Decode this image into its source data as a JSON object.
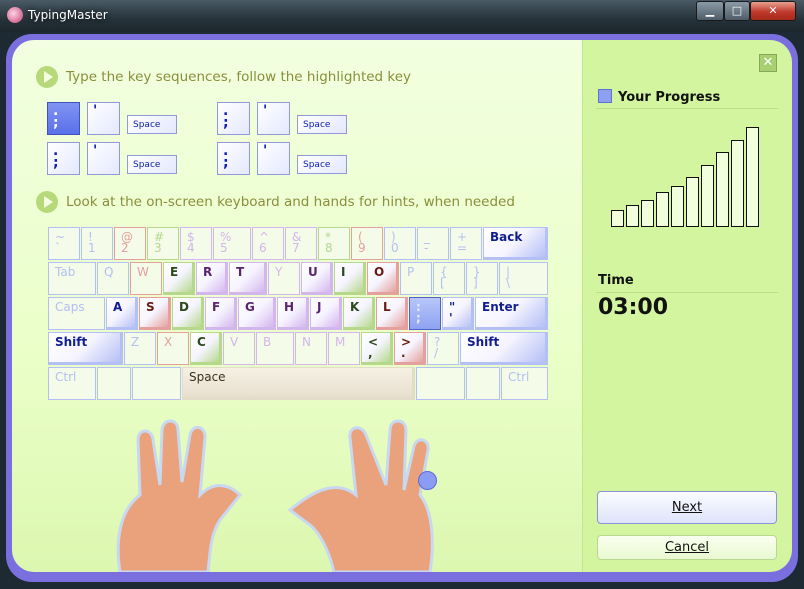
{
  "window": {
    "title": "TypingMaster",
    "minimize": "▁",
    "maximize": "□",
    "close": "✕"
  },
  "instructions": [
    "Type the key sequences, follow the highlighted key",
    "Look at the on-screen keyboard and hands for hints, when needed"
  ],
  "sequence": [
    [
      {
        "label": ".\n;",
        "highlighted": true
      },
      {
        "label": "'"
      },
      {
        "label": "Space",
        "space": true
      },
      {
        "label": ".\n;"
      },
      {
        "label": "'"
      },
      {
        "label": "Space",
        "space": true
      }
    ],
    [
      {
        "label": ".\n;"
      },
      {
        "label": "'"
      },
      {
        "label": "Space",
        "space": true
      },
      {
        "label": ".\n;"
      },
      {
        "label": "'"
      },
      {
        "label": "Space",
        "space": true
      }
    ]
  ],
  "finger_colors": {
    "blue": "#b4bff6",
    "red": "#e4a09c",
    "green": "#b6d88c",
    "purple": "#d4b6ee",
    "peach": "#f0c8a8"
  },
  "keyboard": [
    [
      {
        "l": "~\n`",
        "c": "blue",
        "f": 1
      },
      {
        "l": "!\n1",
        "c": "blue",
        "f": 1
      },
      {
        "l": "@\n2",
        "c": "red",
        "f": 1
      },
      {
        "l": "#\n3",
        "c": "green",
        "f": 1
      },
      {
        "l": "$\n4",
        "c": "purple",
        "f": 1
      },
      {
        "l": "%\n5",
        "c": "purple",
        "f": 1
      },
      {
        "l": "^\n6",
        "c": "purple",
        "f": 1
      },
      {
        "l": "&\n7",
        "c": "purple",
        "f": 1
      },
      {
        "l": "*\n8",
        "c": "green",
        "f": 1
      },
      {
        "l": "(\n9",
        "c": "red",
        "f": 1
      },
      {
        "l": ")\n0",
        "c": "blue",
        "f": 1
      },
      {
        "l": "_\n-",
        "c": "blue",
        "f": 1
      },
      {
        "l": "+\n=",
        "c": "blue",
        "f": 1
      },
      {
        "l": "Back",
        "c": "blue"
      }
    ],
    [
      {
        "l": "Tab",
        "c": "blue",
        "f": 1
      },
      {
        "l": "Q",
        "c": "blue",
        "f": 1
      },
      {
        "l": "W",
        "c": "red",
        "f": 1
      },
      {
        "l": "E",
        "c": "green"
      },
      {
        "l": "R",
        "c": "purple"
      },
      {
        "l": "T",
        "c": "purple"
      },
      {
        "l": "Y",
        "c": "purple",
        "f": 1
      },
      {
        "l": "U",
        "c": "purple"
      },
      {
        "l": "I",
        "c": "green"
      },
      {
        "l": "O",
        "c": "red"
      },
      {
        "l": "P",
        "c": "blue",
        "f": 1
      },
      {
        "l": "{\n[",
        "c": "blue",
        "f": 1
      },
      {
        "l": "}\n]",
        "c": "blue",
        "f": 1
      },
      {
        "l": "|\n\\",
        "c": "blue",
        "f": 1
      }
    ],
    [
      {
        "l": "Caps",
        "c": "blue",
        "f": 1
      },
      {
        "l": "A",
        "c": "blue"
      },
      {
        "l": "S",
        "c": "red"
      },
      {
        "l": "D",
        "c": "green"
      },
      {
        "l": "F",
        "c": "purple"
      },
      {
        "l": "G",
        "c": "purple"
      },
      {
        "l": "H",
        "c": "purple"
      },
      {
        "l": "J",
        "c": "purple"
      },
      {
        "l": "K",
        "c": "green"
      },
      {
        "l": "L",
        "c": "red"
      },
      {
        "l": ":\n;",
        "c": "blue",
        "hl": 1
      },
      {
        "l": "\"\n'",
        "c": "blue"
      },
      {
        "l": "Enter",
        "c": "blue"
      }
    ],
    [
      {
        "l": "Shift",
        "c": "blue"
      },
      {
        "l": "Z",
        "c": "blue",
        "f": 1
      },
      {
        "l": "X",
        "c": "red",
        "f": 1
      },
      {
        "l": "C",
        "c": "green"
      },
      {
        "l": "V",
        "c": "purple",
        "f": 1
      },
      {
        "l": "B",
        "c": "purple",
        "f": 1
      },
      {
        "l": "N",
        "c": "purple",
        "f": 1
      },
      {
        "l": "M",
        "c": "purple",
        "f": 1
      },
      {
        "l": "<\n,",
        "c": "green"
      },
      {
        "l": ">\n.",
        "c": "red"
      },
      {
        "l": "?\n/",
        "c": "blue",
        "f": 1
      },
      {
        "l": "Shift",
        "c": "blue"
      }
    ],
    [
      {
        "l": "Ctrl",
        "c": "blue",
        "f": 1
      },
      {
        "l": "",
        "c": "blue",
        "f": 1
      },
      {
        "l": "",
        "c": "blue",
        "f": 1
      },
      {
        "l": "Space",
        "c": "space"
      },
      {
        "l": "",
        "c": "blue",
        "f": 1
      },
      {
        "l": "",
        "c": "blue",
        "f": 1
      },
      {
        "l": "Ctrl",
        "c": "blue",
        "f": 1
      }
    ]
  ],
  "progress": {
    "title": "Your Progress",
    "bar_levels": [
      17,
      22,
      27,
      35,
      41,
      50,
      62,
      75,
      87,
      100
    ]
  },
  "time": {
    "label": "Time",
    "value": "03:00"
  },
  "buttons": {
    "next": "Next",
    "cancel": "Cancel",
    "close": "✕"
  }
}
